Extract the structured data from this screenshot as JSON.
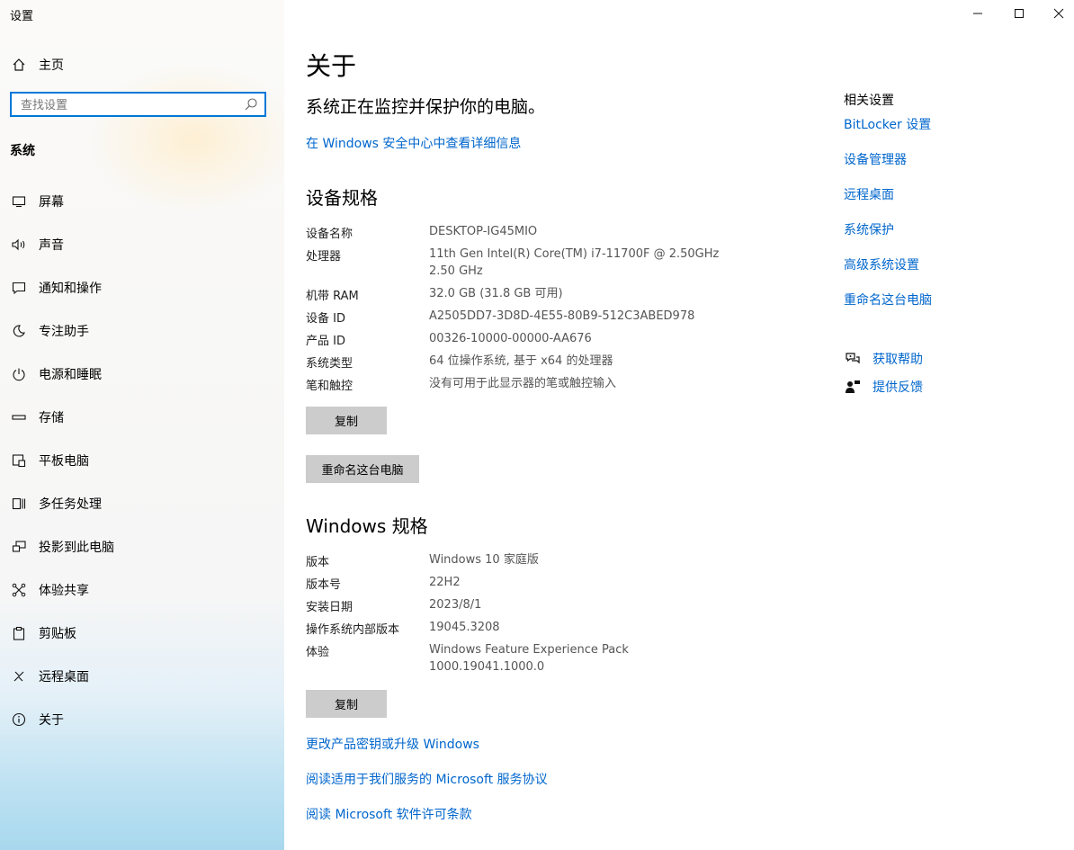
{
  "window": {
    "title": "设置"
  },
  "sidebar": {
    "home_label": "主页",
    "search_placeholder": "查找设置",
    "section_label": "系统",
    "items": [
      {
        "label": "屏幕",
        "icon": "monitor-icon"
      },
      {
        "label": "声音",
        "icon": "speaker-icon"
      },
      {
        "label": "通知和操作",
        "icon": "notification-icon"
      },
      {
        "label": "专注助手",
        "icon": "moon-icon"
      },
      {
        "label": "电源和睡眠",
        "icon": "power-icon"
      },
      {
        "label": "存储",
        "icon": "storage-icon"
      },
      {
        "label": "平板电脑",
        "icon": "tablet-icon"
      },
      {
        "label": "多任务处理",
        "icon": "multitask-icon"
      },
      {
        "label": "投影到此电脑",
        "icon": "project-icon"
      },
      {
        "label": "体验共享",
        "icon": "share-icon"
      },
      {
        "label": "剪贴板",
        "icon": "clipboard-icon"
      },
      {
        "label": "远程桌面",
        "icon": "remote-icon"
      },
      {
        "label": "关于",
        "icon": "info-icon"
      }
    ]
  },
  "main": {
    "title": "关于",
    "protect_text": "系统正在监控并保护你的电脑。",
    "security_link": "在 Windows 安全中心中查看详细信息",
    "device_specs": {
      "heading": "设备规格",
      "rows": [
        {
          "key": "设备名称",
          "value": "DESKTOP-IG45MIO"
        },
        {
          "key": "处理器",
          "value": "11th Gen Intel(R) Core(TM) i7-11700F @ 2.50GHz",
          "value2": "2.50 GHz"
        },
        {
          "key": "机带 RAM",
          "value": "32.0 GB (31.8 GB 可用)"
        },
        {
          "key": "设备 ID",
          "value": "A2505DD7-3D8D-4E55-80B9-512C3ABED978"
        },
        {
          "key": "产品 ID",
          "value": "00326-10000-00000-AA676"
        },
        {
          "key": "系统类型",
          "value": "64 位操作系统, 基于 x64 的处理器"
        },
        {
          "key": "笔和触控",
          "value": "没有可用于此显示器的笔或触控输入"
        }
      ],
      "copy_label": "复制",
      "rename_label": "重命名这台电脑"
    },
    "windows_specs": {
      "heading": "Windows 规格",
      "rows": [
        {
          "key": "版本",
          "value": "Windows 10 家庭版"
        },
        {
          "key": "版本号",
          "value": "22H2"
        },
        {
          "key": "安装日期",
          "value": "2023/8/1"
        },
        {
          "key": "操作系统内部版本",
          "value": "19045.3208"
        },
        {
          "key": "体验",
          "value": "Windows Feature Experience Pack",
          "value2": "1000.19041.1000.0"
        }
      ],
      "copy_label": "复制"
    },
    "links": [
      "更改产品密钥或升级 Windows",
      "阅读适用于我们服务的 Microsoft 服务协议",
      "阅读 Microsoft 软件许可条款"
    ]
  },
  "related": {
    "title": "相关设置",
    "links": [
      "BitLocker 设置",
      "设备管理器",
      "远程桌面",
      "系统保护",
      "高级系统设置",
      "重命名这台电脑"
    ],
    "help_label": "获取帮助",
    "feedback_label": "提供反馈"
  },
  "colors": {
    "accent": "#0078d7",
    "link": "#0066cc",
    "button": "#cccccc"
  }
}
